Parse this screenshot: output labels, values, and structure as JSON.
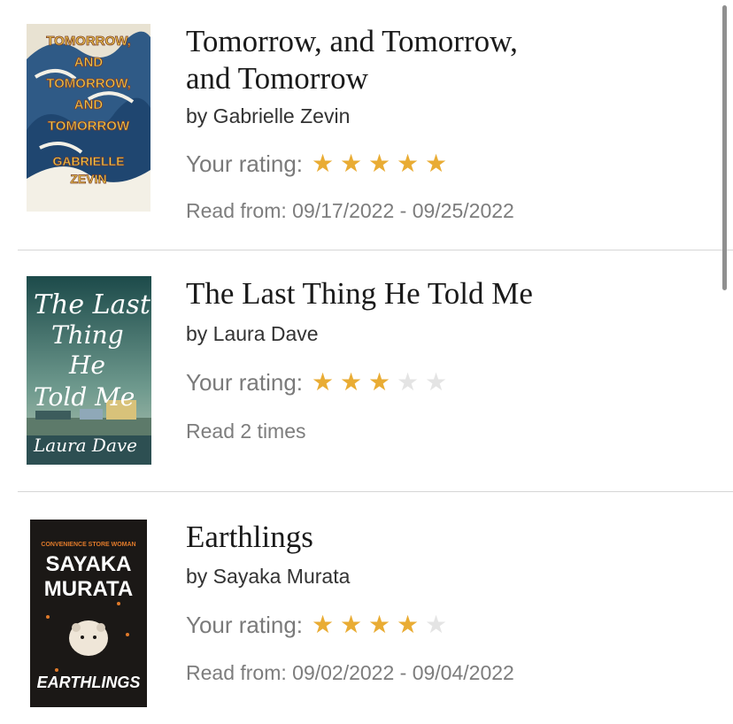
{
  "colors": {
    "star_on": "#e9ac34",
    "star_off": "#e4e4e4",
    "title": "#1a1a1a",
    "muted": "#7d7d7d",
    "divider": "#d6d6d6"
  },
  "books": [
    {
      "title_line1": "Tomorrow, and Tomorrow,",
      "title_line2": "and Tomorrow",
      "author": "by Gabrielle Zevin",
      "rating_label": "Your rating:",
      "rating": 5,
      "rating_max": 5,
      "meta": "Read from: 09/17/2022 - 09/25/2022",
      "cover": {
        "icon": "great-wave-cover",
        "lines": [
          "TOMORROW,",
          "AND",
          "TOMORROW,",
          "AND",
          "TOMORROW"
        ],
        "author_lines": [
          "GABRIELLE",
          "ZEVIN"
        ]
      }
    },
    {
      "title_line1": "The Last Thing He Told Me",
      "title_line2": "",
      "author": "by Laura Dave",
      "rating_label": "Your rating:",
      "rating": 3,
      "rating_max": 5,
      "meta": "Read 2 times",
      "cover": {
        "icon": "marina-cover",
        "lines": [
          "The Last",
          "Thing",
          "He",
          "Told Me"
        ],
        "author_lines": [
          "Laura Dave"
        ]
      }
    },
    {
      "title_line1": "Earthlings",
      "title_line2": "",
      "author": "by Sayaka Murata",
      "rating_label": "Your rating:",
      "rating": 4,
      "rating_max": 5,
      "meta": "Read from: 09/02/2022 - 09/04/2022",
      "cover": {
        "icon": "hamster-cover",
        "tagline": "CONVENIENCE STORE WOMAN",
        "lines": [
          "SAYAKA",
          "MURATA"
        ],
        "author_lines": [
          "EARTHLINGS"
        ]
      }
    }
  ]
}
